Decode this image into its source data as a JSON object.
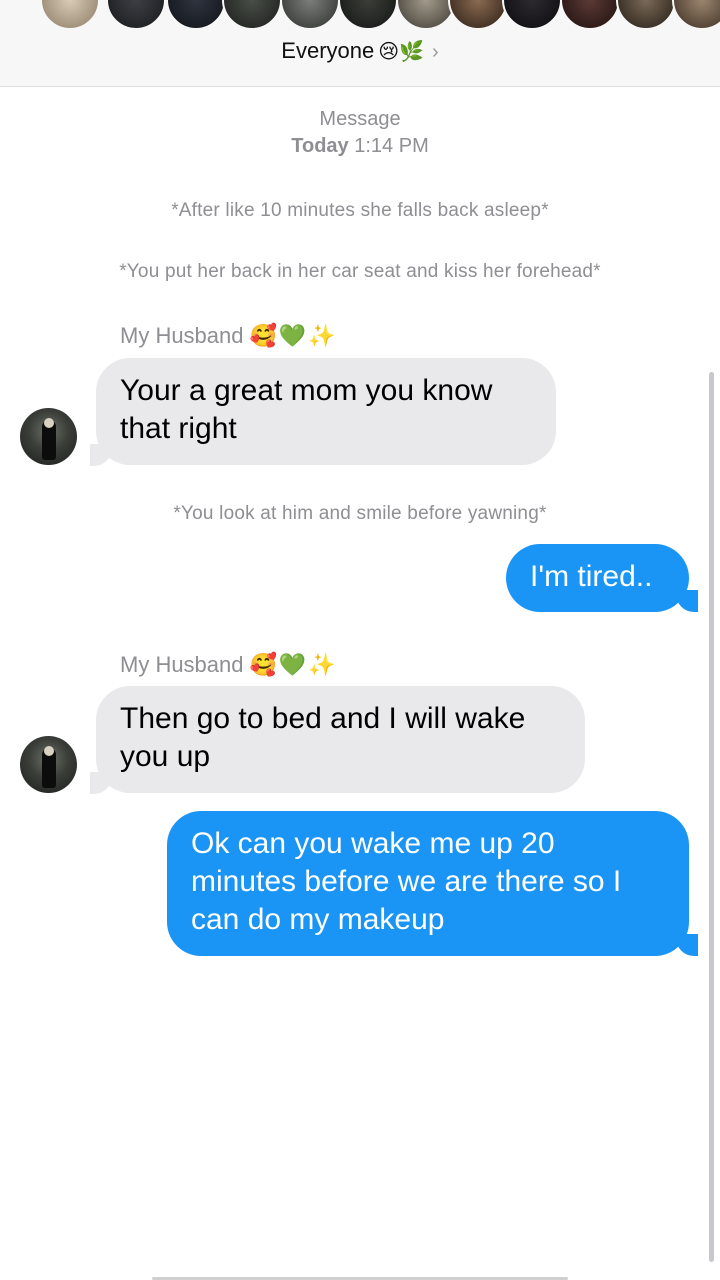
{
  "header": {
    "group_name": "Everyone",
    "group_emoji": "😢🌿",
    "chevron": "›",
    "avatar_count": 13
  },
  "timestamp": {
    "service": "Message",
    "day": "Today",
    "time": "1:14 PM"
  },
  "messages": [
    {
      "kind": "narration",
      "text": "*After like 10 minutes she falls back asleep*"
    },
    {
      "kind": "narration",
      "text": "*You put her back in her car seat and kiss her forehead*"
    },
    {
      "kind": "sender",
      "name": "My Husband",
      "emoji": "🥰💚✨"
    },
    {
      "kind": "incoming",
      "text": "Your a great mom you know that right"
    },
    {
      "kind": "narration",
      "text": "*You look at him and smile before yawning*"
    },
    {
      "kind": "outgoing",
      "text": "I'm tired.."
    },
    {
      "kind": "sender",
      "name": "My Husband",
      "emoji": "🥰💚✨"
    },
    {
      "kind": "incoming",
      "text": "Then go to bed and I will wake you up"
    },
    {
      "kind": "outgoing",
      "text": "Ok can you wake me up 20 minutes before we are there so I can do my makeup"
    }
  ],
  "colors": {
    "outgoing_bubble": "#1b95f5",
    "incoming_bubble": "#e9e9eb",
    "meta_text": "#8e8e93"
  },
  "icons": {
    "contact_avatar": "profile-photo",
    "header_chevron": "chevron-right-icon"
  }
}
